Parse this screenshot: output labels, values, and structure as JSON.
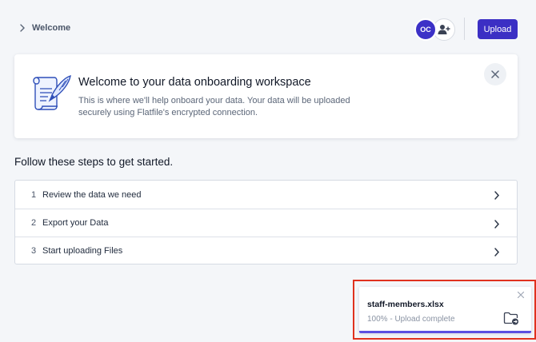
{
  "header": {
    "breadcrumb": "Welcome",
    "avatar_initials": "OC",
    "upload_label": "Upload"
  },
  "welcome": {
    "title": "Welcome to your data onboarding workspace",
    "description": "This is where we'll help onboard your data. Your data will be uploaded securely using Flatfile's encrypted connection."
  },
  "steps": {
    "heading": "Follow these steps to get started.",
    "items": [
      {
        "number": "1",
        "label": "Review the data we need"
      },
      {
        "number": "2",
        "label": "Export your Data"
      },
      {
        "number": "3",
        "label": "Start uploading Files"
      }
    ]
  },
  "toast": {
    "filename": "staff-members.xlsx",
    "status": "100% - Upload complete",
    "progress": 1.0
  },
  "colors": {
    "accent": "#3b2fc4",
    "highlight_frame": "#e0321f",
    "progress": "#5b4fe0"
  }
}
